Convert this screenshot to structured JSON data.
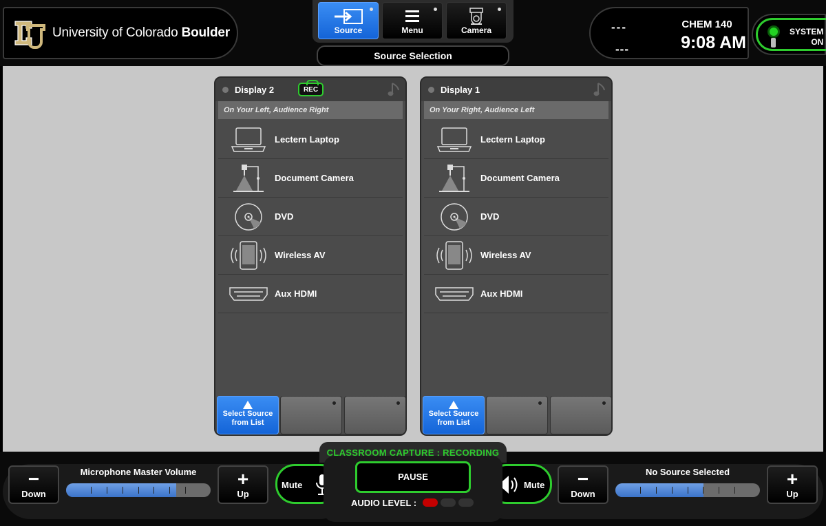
{
  "header": {
    "org_name_light": "University of Colorado",
    "org_name_bold": "Boulder",
    "nav": [
      {
        "label": "Source",
        "icon": "source-arrow-icon",
        "active": true
      },
      {
        "label": "Menu",
        "icon": "hamburger-menu-icon",
        "active": false
      },
      {
        "label": "Camera",
        "icon": "camera-icon",
        "active": false
      }
    ],
    "page_title": "Source Selection",
    "status_line1": "---",
    "status_line2": "---",
    "room": "CHEM 140",
    "time": "9:08 AM",
    "power": {
      "line1": "SYSTEM",
      "line2": "ON"
    }
  },
  "displays": [
    {
      "title": "Display 2",
      "rec_badge": "REC",
      "subtitle": "On Your Left, Audience Right",
      "sources": [
        {
          "label": "Lectern Laptop",
          "icon": "laptop-icon"
        },
        {
          "label": "Document Camera",
          "icon": "document-camera-icon"
        },
        {
          "label": "DVD",
          "icon": "disc-icon"
        },
        {
          "label": "Wireless AV",
          "icon": "wireless-tablet-icon"
        },
        {
          "label": "Aux HDMI",
          "icon": "hdmi-icon"
        }
      ],
      "select_button": {
        "line1": "Select Source",
        "line2": "from List"
      }
    },
    {
      "title": "Display 1",
      "rec_badge": "",
      "subtitle": "On Your Right, Audience Left",
      "sources": [
        {
          "label": "Lectern Laptop",
          "icon": "laptop-icon"
        },
        {
          "label": "Document Camera",
          "icon": "document-camera-icon"
        },
        {
          "label": "DVD",
          "icon": "disc-icon"
        },
        {
          "label": "Wireless AV",
          "icon": "wireless-tablet-icon"
        },
        {
          "label": "Aux HDMI",
          "icon": "hdmi-icon"
        }
      ],
      "select_button": {
        "line1": "Select Source",
        "line2": "from List"
      }
    }
  ],
  "footer": {
    "capture_status": "CLASSROOM CAPTURE : RECORDING",
    "pause_label": "PAUSE",
    "audio_level_label": "AUDIO LEVEL :",
    "audio_level_segments_on": 1,
    "mic": {
      "title": "Microphone Master Volume",
      "down": "Down",
      "up": "Up",
      "mute": "Mute",
      "level": 0.76
    },
    "program": {
      "title": "No Source Selected",
      "down": "Down",
      "up": "Up",
      "mute": "Mute",
      "level": 0.61
    }
  },
  "colors": {
    "accent_blue": "#1e78f0",
    "recording_green": "#2ecc2e",
    "meter_red": "#c40000"
  }
}
